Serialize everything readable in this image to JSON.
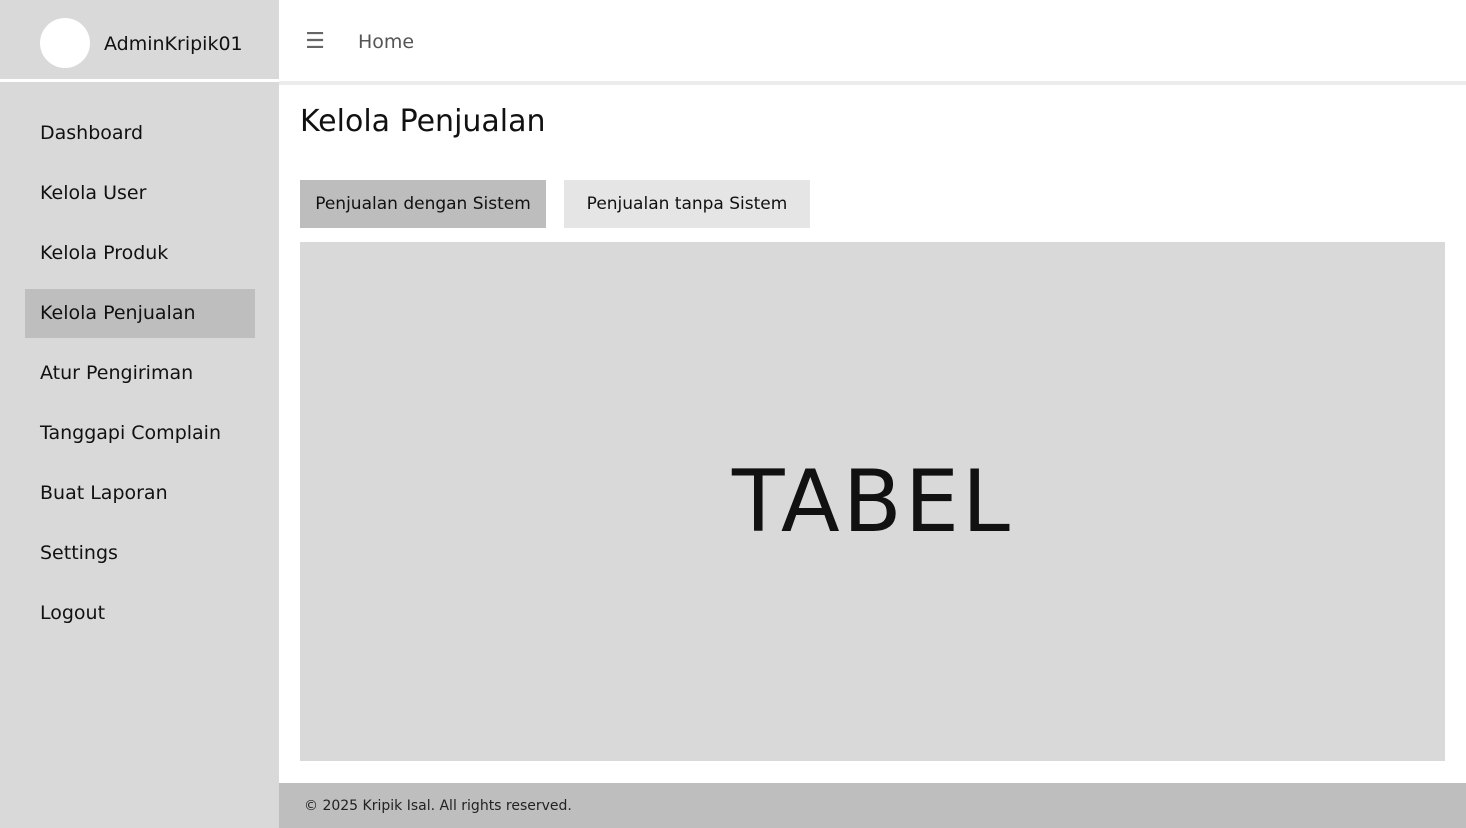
{
  "sidebar": {
    "username": "AdminKripik01",
    "items": [
      {
        "label": "Dashboard"
      },
      {
        "label": "Kelola User"
      },
      {
        "label": "Kelola Produk"
      },
      {
        "label": "Kelola Penjualan"
      },
      {
        "label": "Atur Pengiriman"
      },
      {
        "label": "Tanggapi Complain"
      },
      {
        "label": "Buat Laporan"
      },
      {
        "label": "Settings"
      },
      {
        "label": "Logout"
      }
    ],
    "active_item": "Kelola Penjualan"
  },
  "header": {
    "menu_icon": "hamburger-icon",
    "breadcrumb": "Home"
  },
  "main": {
    "title": "Kelola Penjualan",
    "tabs": [
      {
        "label": "Penjualan dengan Sistem",
        "selected": true
      },
      {
        "label": "Penjualan tanpa Sistem",
        "selected": false
      }
    ],
    "table_placeholder": "TABEL"
  },
  "footer": {
    "text": "© 2025 Kripik Isal. All rights reserved."
  },
  "colors": {
    "sidebar_bg": "#d9d9d9",
    "active_item_bg": "#bebebe",
    "selected_tab_bg": "#bdbdbd",
    "unselected_tab_bg": "#e5e5e5",
    "footer_bg": "#bebebe"
  }
}
